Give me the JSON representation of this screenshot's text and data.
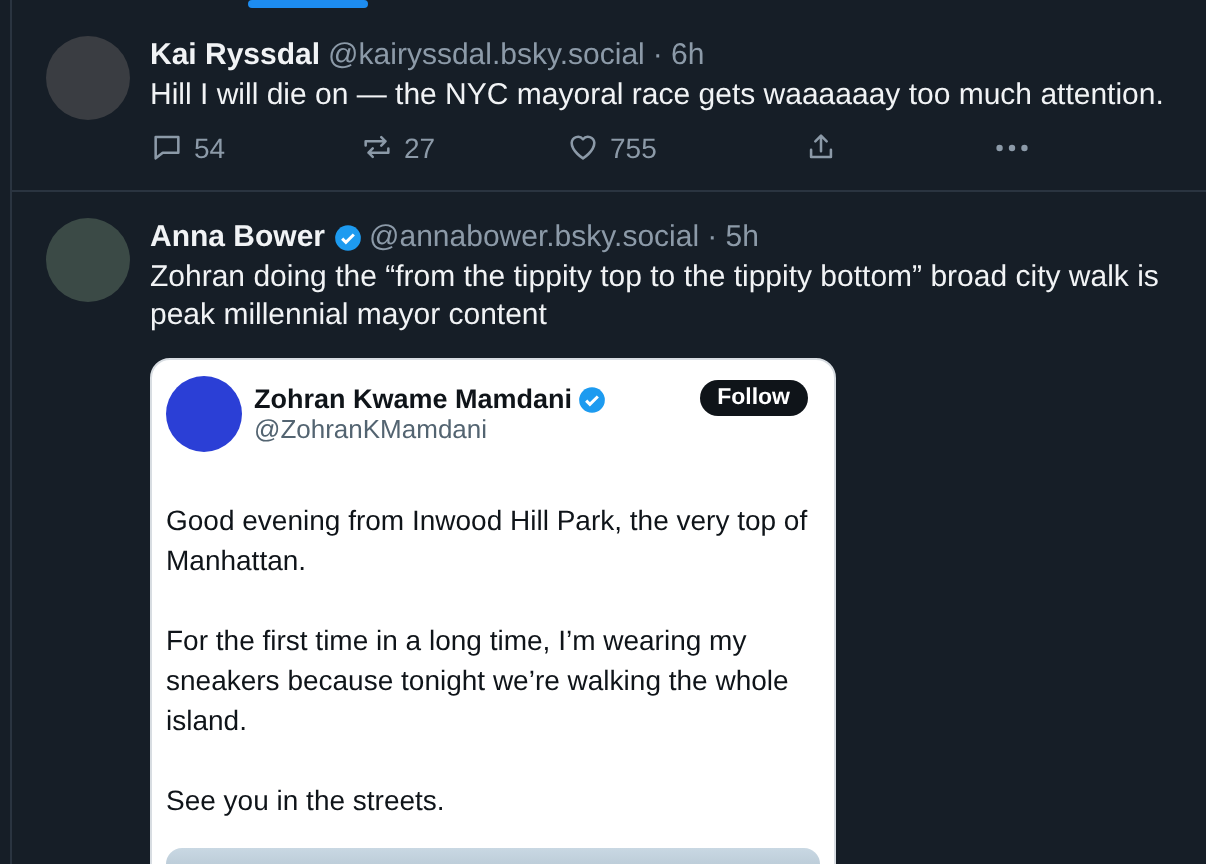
{
  "tabs_indicator": {
    "selected": true
  },
  "posts": [
    {
      "name": "Kai Ryssdal",
      "verified": false,
      "handle": "@kairyssdal.bsky.social",
      "time": "· 6h",
      "text": "Hill I will die on — the NYC mayoral race gets waaaaaay too much attention.",
      "actions": {
        "replies": "54",
        "reposts": "27",
        "likes": "755"
      }
    },
    {
      "name": "Anna Bower",
      "verified": true,
      "handle": "@annabower.bsky.social",
      "time": "· 5h",
      "text": "Zohran doing the “from the tippity top to the tippity bottom” broad city walk is peak millennial mayor content",
      "embed": {
        "name": "Zohran Kwame Mamdani",
        "verified": true,
        "handle": "@ZohranKMamdani",
        "follow": "Follow",
        "paragraphs": [
          "Good evening from Inwood Hill Park, the very top of Manhattan.",
          "For the first time in a long time, I’m wearing my sneakers because tonight we’re walking the whole island.",
          "See you in the streets."
        ]
      }
    }
  ]
}
